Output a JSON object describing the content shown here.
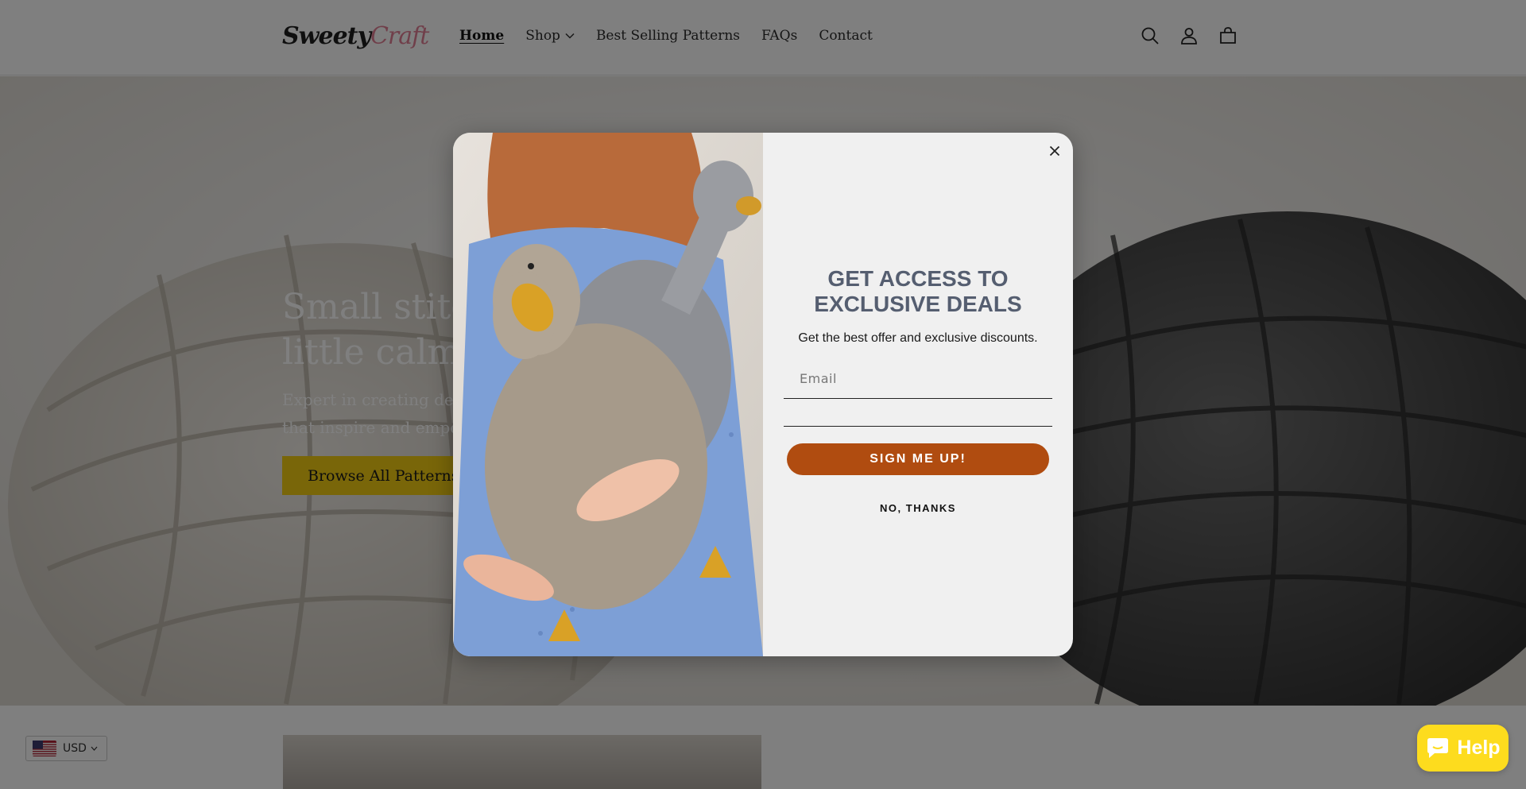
{
  "header": {
    "logo": {
      "part1": "Sweety",
      "part2": "Craft"
    },
    "nav": [
      {
        "label": "Home",
        "active": true,
        "has_dropdown": false
      },
      {
        "label": "Shop",
        "active": false,
        "has_dropdown": true
      },
      {
        "label": "Best Selling Patterns",
        "active": false,
        "has_dropdown": false
      },
      {
        "label": "FAQs",
        "active": false,
        "has_dropdown": false
      },
      {
        "label": "Contact",
        "active": false,
        "has_dropdown": false
      }
    ],
    "icons": [
      "search-icon",
      "account-icon",
      "cart-icon"
    ]
  },
  "hero": {
    "title": "Small stitches, a\nlittle calm",
    "subtitle": "Expert in creating detailed patterns\nthat inspire and empower",
    "button_label": "Browse All Patterns"
  },
  "currency": {
    "code": "USD",
    "flag": "us-flag-icon"
  },
  "help": {
    "label": "Help"
  },
  "popup": {
    "title": "GET ACCESS TO\nEXCLUSIVE DEALS",
    "subtitle": "Get the best offer and exclusive discounts.",
    "email_placeholder": "Email",
    "email_value": "",
    "signup_label": "SIGN ME UP!",
    "dismiss_label": "NO, THANKS"
  },
  "colors": {
    "accent_yellow": "#f3cd13",
    "signup_orange": "#b04c10",
    "help_yellow": "#fddc1e",
    "popup_title": "#555e70"
  }
}
